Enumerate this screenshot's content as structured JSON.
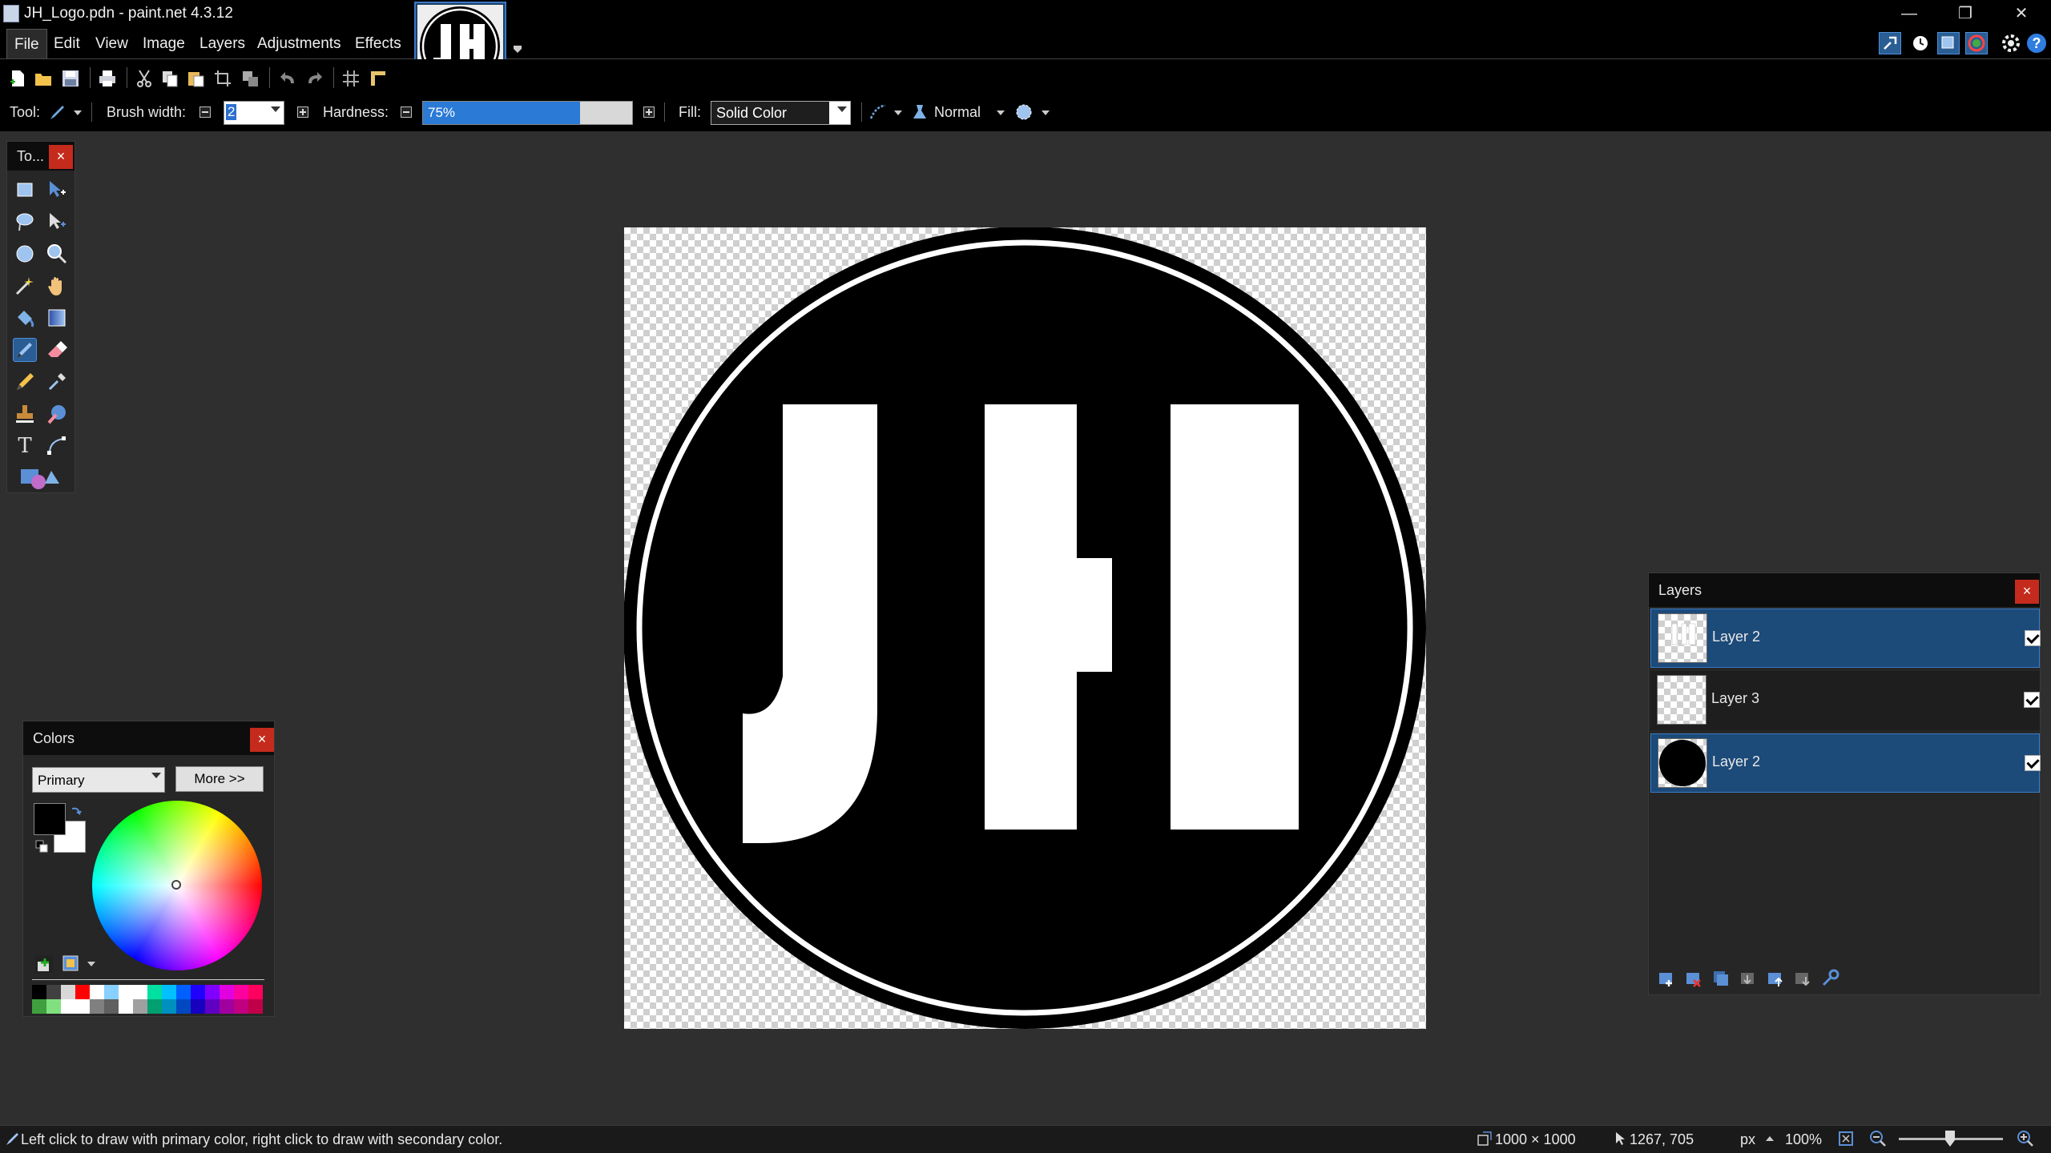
{
  "window": {
    "title": "JH_Logo.pdn - paint.net 4.3.12",
    "minimize_glyph": "—",
    "restore_glyph": "❐",
    "close_glyph": "✕"
  },
  "menu": {
    "items": [
      "File",
      "Edit",
      "View",
      "Image",
      "Layers",
      "Adjustments",
      "Effects"
    ]
  },
  "toolbar": {
    "tool_label": "Tool:",
    "brush_width_label": "Brush width:",
    "brush_width_value": "2",
    "hardness_label": "Hardness:",
    "hardness_value": "75%",
    "hardness_fraction": 0.75,
    "fill_label": "Fill:",
    "fill_value": "Solid Color",
    "blend_mode": "Normal"
  },
  "tools_panel": {
    "title": "To...",
    "close_glyph": "×",
    "text_tool_glyph": "T"
  },
  "colors_panel": {
    "title": "Colors",
    "close_glyph": "×",
    "mode_select": "Primary",
    "more_button": "More >>",
    "primary_color": "#000000",
    "secondary_color": "#ffffff"
  },
  "layers_panel": {
    "title": "Layers",
    "close_glyph": "×",
    "layers": [
      {
        "name": "Layer 2",
        "selected": true,
        "visible": true
      },
      {
        "name": "Layer 3",
        "selected": false,
        "visible": true
      },
      {
        "name": "Layer 2",
        "selected": true,
        "visible": true
      }
    ]
  },
  "canvas": {
    "logo_text": "JH"
  },
  "status": {
    "hint": "Left click to draw with primary color, right click to draw with secondary color.",
    "image_size": "1000 × 1000",
    "cursor_position": "1267, 705",
    "units": "px",
    "zoom": "100%"
  },
  "colors": {
    "accent": "#2a5d94",
    "selection": "#1c4a79",
    "close_red": "#c42b1c"
  }
}
